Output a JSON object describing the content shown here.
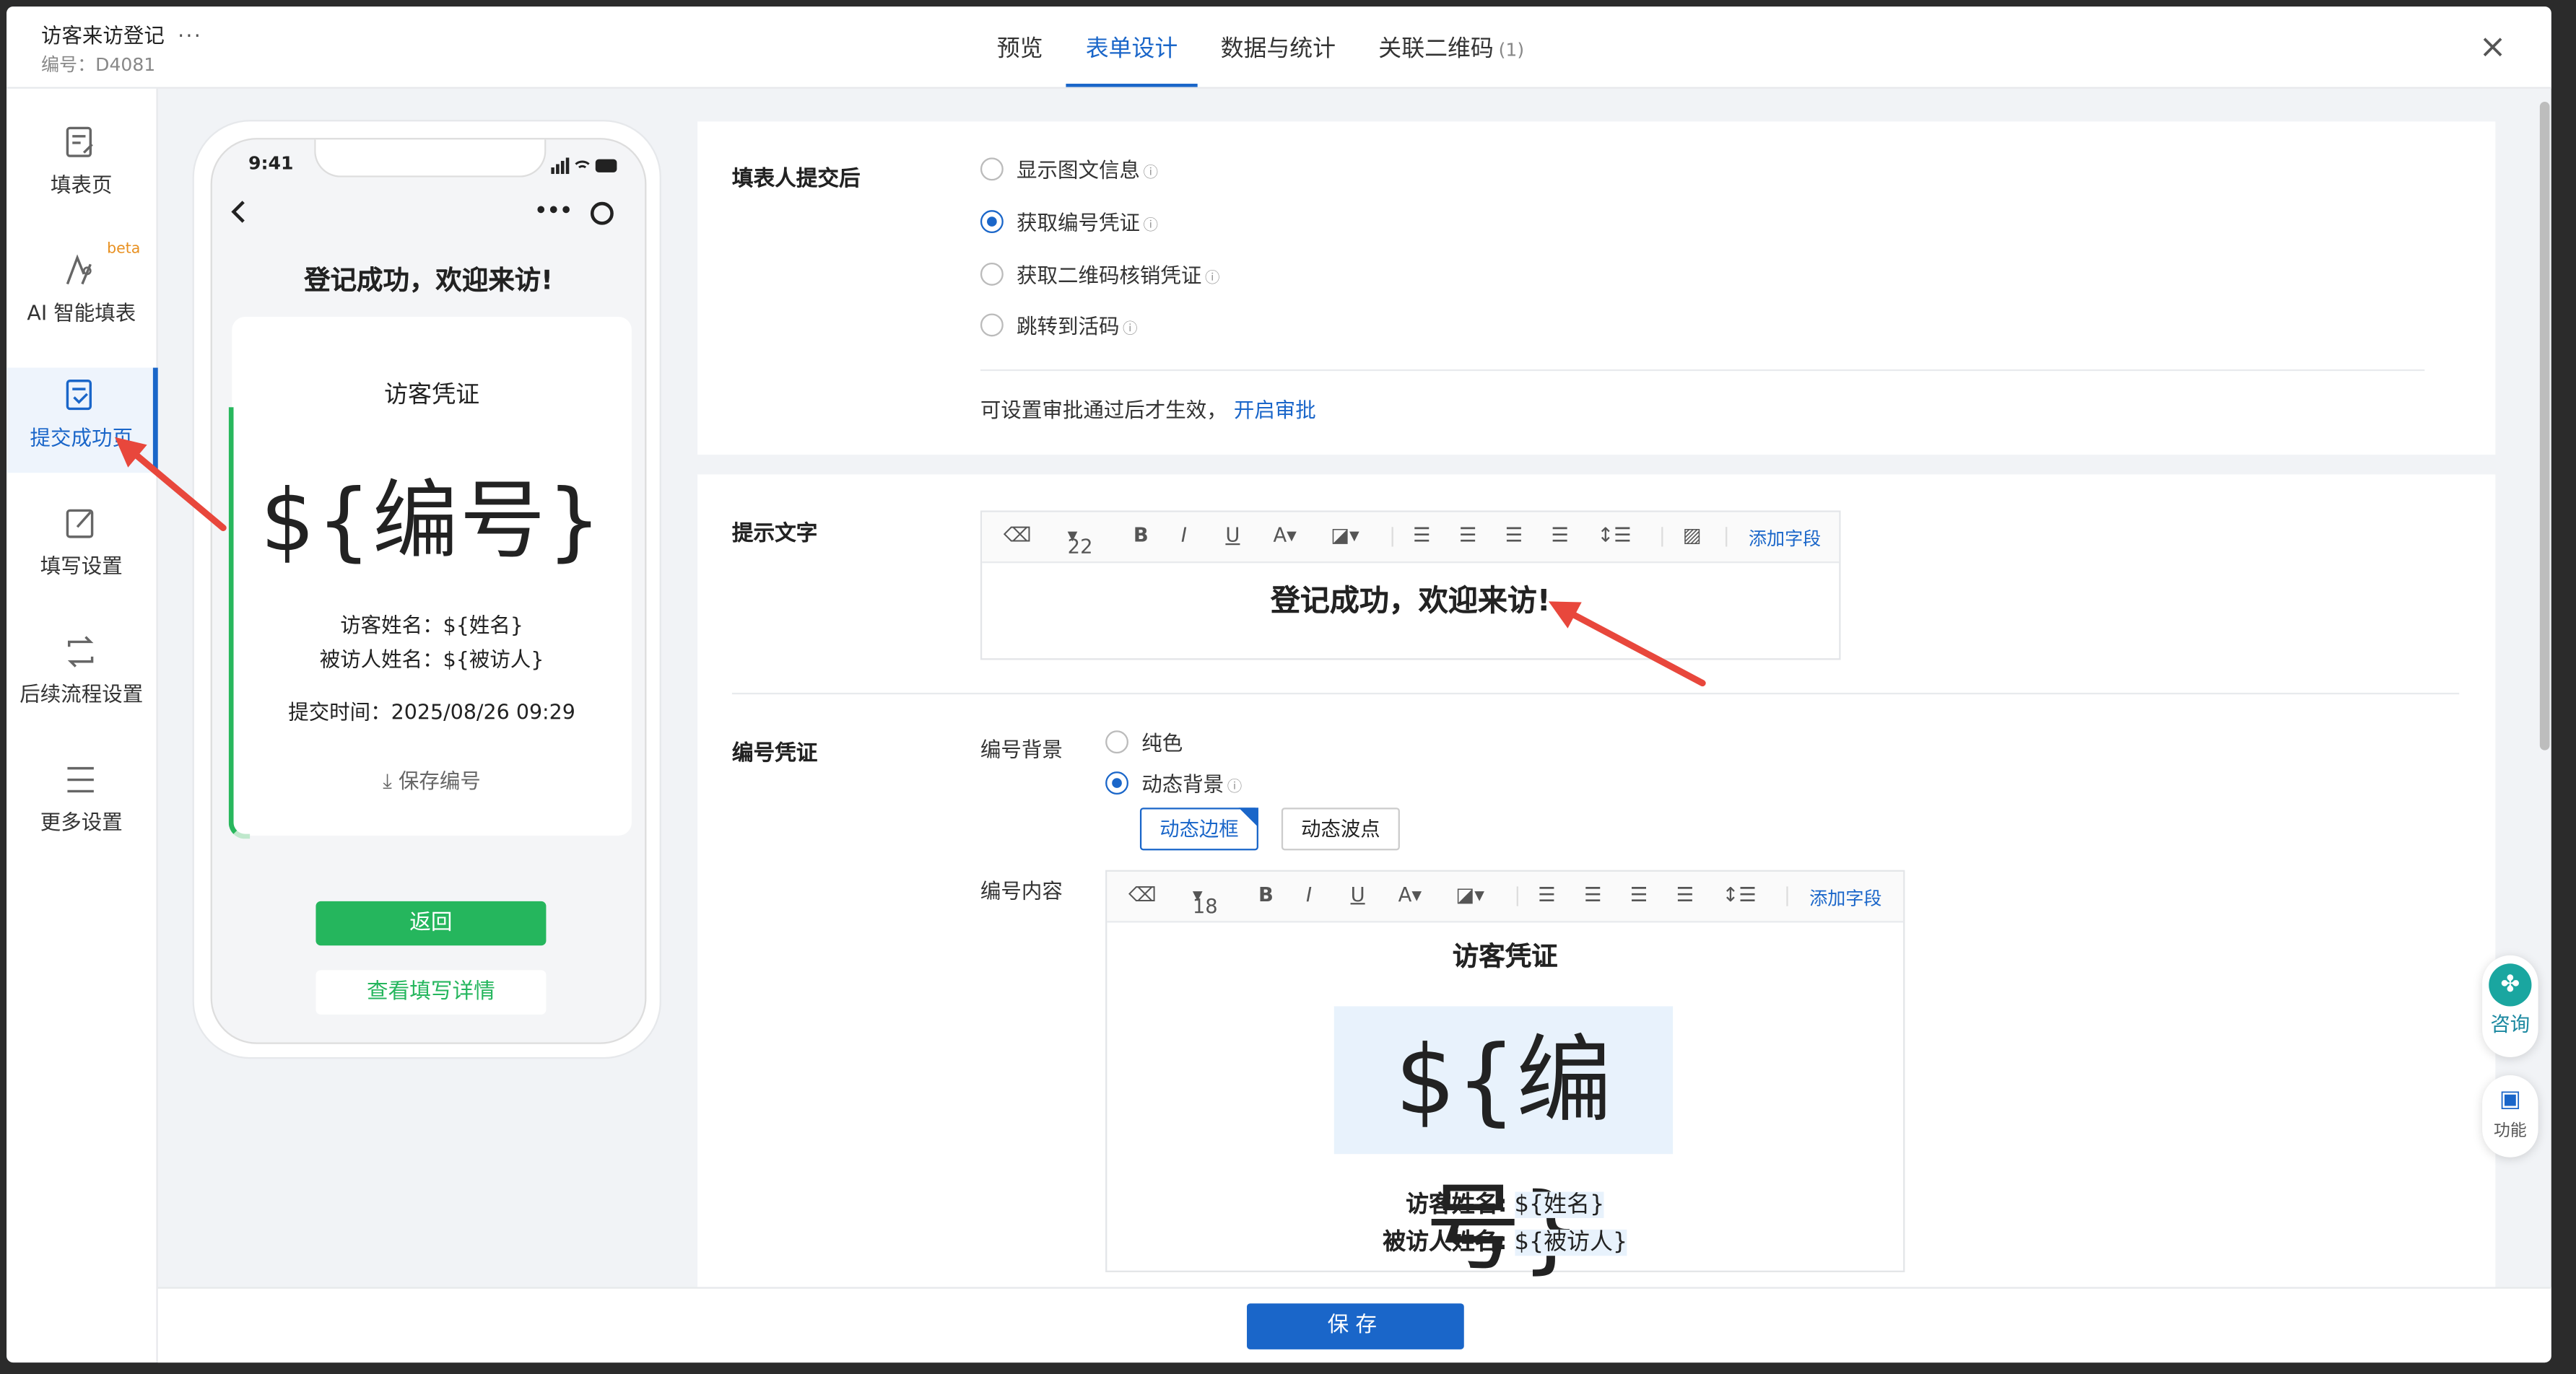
{
  "header": {
    "title": "访客来访登记",
    "more": "···",
    "code": "编号：D4081",
    "tabs": [
      {
        "label": "预览",
        "count": ""
      },
      {
        "label": "表单设计",
        "count": ""
      },
      {
        "label": "数据与统计",
        "count": ""
      },
      {
        "label": "关联二维码",
        "count": "(1)"
      }
    ],
    "close": "×"
  },
  "sidebar": {
    "items": [
      {
        "label": "填表页",
        "icon": "form-page-icon"
      },
      {
        "label": "AI 智能填表",
        "icon": "ai-icon",
        "badge": "beta"
      },
      {
        "label": "提交成功页",
        "icon": "submit-success-icon"
      },
      {
        "label": "填写设置",
        "icon": "edit-settings-icon"
      },
      {
        "label": "后续流程设置",
        "icon": "workflow-icon"
      },
      {
        "label": "更多设置",
        "icon": "menu-icon"
      }
    ]
  },
  "phone": {
    "time": "9:41",
    "page_title": "登记成功，欢迎来访!",
    "card_title": "访客凭证",
    "number": "${编号}",
    "visitor": "访客姓名：${姓名}",
    "visitee": "被访人姓名：${被访人}",
    "submit_time": "提交时间：2025/08/26 09:29",
    "save_number": "保存编号",
    "back_button": "返回",
    "detail_button": "查看填写详情"
  },
  "after_submit": {
    "label": "填表人提交后",
    "options": [
      {
        "label": "显示图文信息",
        "checked": false
      },
      {
        "label": "获取编号凭证",
        "checked": true
      },
      {
        "label": "获取二维码核销凭证",
        "checked": false
      },
      {
        "label": "跳转到活码",
        "checked": false
      }
    ],
    "approval_text": "可设置审批通过后才生效，",
    "approval_link": "开启审批"
  },
  "hint_text": {
    "label": "提示文字",
    "font_size": "22",
    "add_field": "添加字段",
    "content": "登记成功，欢迎来访!"
  },
  "number_voucher": {
    "label": "编号凭证",
    "bg_label": "编号背景",
    "bg_options": [
      {
        "label": "纯色",
        "checked": false
      },
      {
        "label": "动态背景",
        "checked": true
      }
    ],
    "chips": [
      "动态边框",
      "动态波点"
    ],
    "content_label": "编号内容",
    "font_size": "18",
    "add_field": "添加字段",
    "title": "访客凭证",
    "number": "${编号}",
    "visitor_label": "访客姓名:",
    "visitor_value": "${姓名}",
    "visitee_label": "被访人姓名:",
    "visitee_value": "${被访人}"
  },
  "footer": {
    "save": "保存"
  },
  "floating": {
    "consult": "咨询",
    "function": "功能"
  },
  "colors": {
    "accent": "#1a66c9",
    "green": "#25b65d",
    "arrow": "#e8473c"
  }
}
